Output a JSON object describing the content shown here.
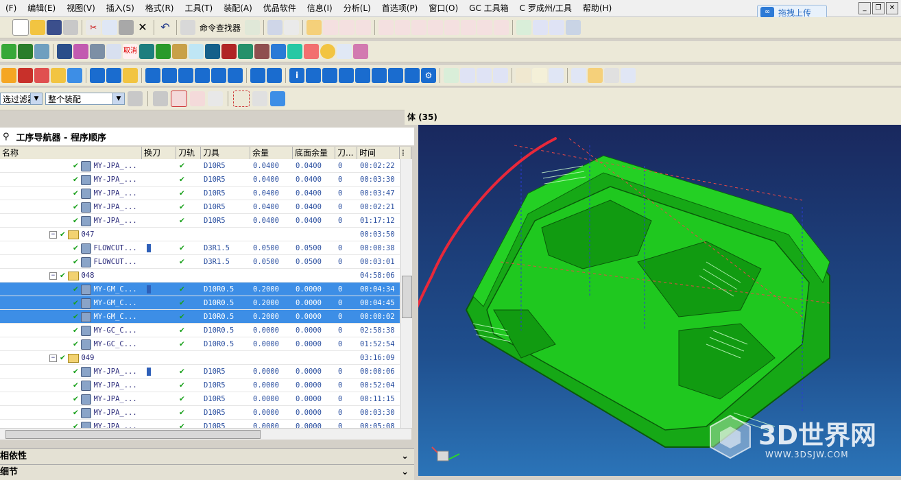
{
  "menubar": {
    "items": [
      "(F)",
      "编辑(E)",
      "视图(V)",
      "插入(S)",
      "格式(R)",
      "工具(T)",
      "装配(A)",
      "优品软件",
      "信息(I)",
      "分析(L)",
      "首选项(P)",
      "窗口(O)",
      "GC 工具箱",
      "C 罗成州/工具",
      "帮助(H)"
    ],
    "upload_label": "拖拽上传",
    "upload_logo": "∞"
  },
  "toolbar1": {
    "command_finder_label": "命令查找器"
  },
  "filterbar": {
    "filter_value": "选过滤器",
    "assembly_value": "整个装配"
  },
  "navigator": {
    "title": "工序导航器 - 程序顺序",
    "columns": [
      "名称",
      "换刀",
      "刀轨",
      "刀具",
      "余量",
      "底面余量",
      "刀...",
      "时间"
    ],
    "rows": [
      {
        "kind": "op",
        "name": "MY-JPA_...",
        "tc": false,
        "path": "✔",
        "tool": "D10R5",
        "stock": "0.0400",
        "floor": "0.0400",
        "tc2": "0",
        "time": "00:02:22",
        "sel": false
      },
      {
        "kind": "op",
        "name": "MY-JPA_...",
        "tc": false,
        "path": "✔",
        "tool": "D10R5",
        "stock": "0.0400",
        "floor": "0.0400",
        "tc2": "0",
        "time": "00:03:30",
        "sel": false
      },
      {
        "kind": "op",
        "name": "MY-JPA_...",
        "tc": false,
        "path": "✔",
        "tool": "D10R5",
        "stock": "0.0400",
        "floor": "0.0400",
        "tc2": "0",
        "time": "00:03:47",
        "sel": false
      },
      {
        "kind": "op",
        "name": "MY-JPA_...",
        "tc": false,
        "path": "✔",
        "tool": "D10R5",
        "stock": "0.0400",
        "floor": "0.0400",
        "tc2": "0",
        "time": "00:02:21",
        "sel": false
      },
      {
        "kind": "op",
        "name": "MY-JPA_...",
        "tc": false,
        "path": "✔",
        "tool": "D10R5",
        "stock": "0.0400",
        "floor": "0.0400",
        "tc2": "0",
        "time": "01:17:12",
        "sel": false
      },
      {
        "kind": "group",
        "name": "047",
        "time": "00:03:50",
        "toggle": "−"
      },
      {
        "kind": "op",
        "name": "FLOWCUT...",
        "tc": true,
        "path": "✔",
        "tool": "D3R1.5",
        "stock": "0.0500",
        "floor": "0.0500",
        "tc2": "0",
        "time": "00:00:38",
        "sel": false
      },
      {
        "kind": "op",
        "name": "FLOWCUT...",
        "tc": false,
        "path": "✔",
        "tool": "D3R1.5",
        "stock": "0.0500",
        "floor": "0.0500",
        "tc2": "0",
        "time": "00:03:01",
        "sel": false
      },
      {
        "kind": "group",
        "name": "048",
        "time": "04:58:06",
        "toggle": "−"
      },
      {
        "kind": "op",
        "name": "MY-GM_C...",
        "tc": true,
        "path": "✔",
        "tool": "D10R0.5",
        "stock": "0.2000",
        "floor": "0.0000",
        "tc2": "0",
        "time": "00:04:34",
        "sel": true
      },
      {
        "kind": "op",
        "name": "MY-GM_C...",
        "tc": false,
        "path": "✔",
        "tool": "D10R0.5",
        "stock": "0.2000",
        "floor": "0.0000",
        "tc2": "0",
        "time": "00:04:45",
        "sel": true
      },
      {
        "kind": "op",
        "name": "MY-GM_C...",
        "tc": false,
        "path": "✔",
        "tool": "D10R0.5",
        "stock": "0.2000",
        "floor": "0.0000",
        "tc2": "0",
        "time": "00:00:02",
        "sel": true
      },
      {
        "kind": "op",
        "name": "MY-GC_C...",
        "tc": false,
        "path": "✔",
        "tool": "D10R0.5",
        "stock": "0.0000",
        "floor": "0.0000",
        "tc2": "0",
        "time": "02:58:38",
        "sel": false
      },
      {
        "kind": "op",
        "name": "MY-GC_C...",
        "tc": false,
        "path": "✔",
        "tool": "D10R0.5",
        "stock": "0.0000",
        "floor": "0.0000",
        "tc2": "0",
        "time": "01:52:54",
        "sel": false
      },
      {
        "kind": "group",
        "name": "049",
        "time": "03:16:09",
        "toggle": "−"
      },
      {
        "kind": "op",
        "name": "MY-JPA_...",
        "tc": true,
        "path": "✔",
        "tool": "D10R5",
        "stock": "0.0000",
        "floor": "0.0000",
        "tc2": "0",
        "time": "00:00:06",
        "sel": false
      },
      {
        "kind": "op",
        "name": "MY-JPA_...",
        "tc": false,
        "path": "✔",
        "tool": "D10R5",
        "stock": "0.0000",
        "floor": "0.0000",
        "tc2": "0",
        "time": "00:52:04",
        "sel": false
      },
      {
        "kind": "op",
        "name": "MY-JPA_...",
        "tc": false,
        "path": "✔",
        "tool": "D10R5",
        "stock": "0.0000",
        "floor": "0.0000",
        "tc2": "0",
        "time": "00:11:15",
        "sel": false
      },
      {
        "kind": "op",
        "name": "MY-JPA_...",
        "tc": false,
        "path": "✔",
        "tool": "D10R5",
        "stock": "0.0000",
        "floor": "0.0000",
        "tc2": "0",
        "time": "00:03:30",
        "sel": false
      },
      {
        "kind": "op",
        "name": "MY-JPA_...",
        "tc": false,
        "path": "✔",
        "tool": "D10R5",
        "stock": "0.0000",
        "floor": "0.0000",
        "tc2": "0",
        "time": "00:05:08",
        "sel": false
      }
    ]
  },
  "panels": {
    "dependencies": "相依性",
    "details": "细节"
  },
  "viewport": {
    "title": "体 (35)"
  },
  "watermark": {
    "brand": "3D世界网",
    "url": "WWW.3DSJW.COM"
  },
  "colors": {
    "model_green": "#1fc81f",
    "selection_blue": "#3d8ee6",
    "annotation_red": "#e8283a"
  }
}
